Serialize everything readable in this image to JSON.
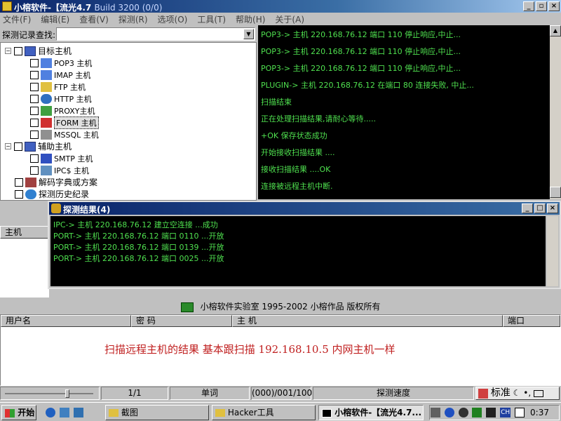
{
  "window": {
    "title": "小榕软件-【流光4.7",
    "title_suffix": "Build 3200 (0/0)"
  },
  "menu": [
    "文件(F)",
    "编辑(E)",
    "查看(V)",
    "探测(R)",
    "选项(O)",
    "工具(T)",
    "帮助(H)",
    "关于(A)"
  ],
  "search": {
    "label": "探测记录查找:",
    "value": ""
  },
  "tree": {
    "root": "目标主机",
    "targets": [
      "POP3 主机",
      "IMAP 主机",
      "FTP  主机",
      "HTTP 主机",
      "PROXY主机",
      "FORM 主机",
      "MSSQL  主机"
    ],
    "aux_root": "辅助主机",
    "aux": [
      "SMTP 主机",
      "IPC$ 主机"
    ],
    "dict": "解码字典或方案",
    "history": "探测历史纪录"
  },
  "console_lines": [
    "POP3-> 主机 220.168.76.12 端口 110 停止响应,中止...",
    "POP3-> 主机 220.168.76.12 端口 110 停止响应,中止...",
    "POP3-> 主机 220.168.76.12 端口 110 停止响应,中止...",
    "PLUGIN-> 主机 220.168.76.12 在端口 80 连接失败, 中止...",
    "扫描结束",
    "正在处理扫描结果,请耐心等待.....",
    "+OK 保存状态成功",
    "开始接收扫描结果 ....",
    "接收扫描结果 ....OK",
    "连接被远程主机中断."
  ],
  "host_panel": {
    "header": "主机"
  },
  "result_window": {
    "title": "探测结果(4)",
    "lines": [
      "IPC-> 主机 220.168.76.12 建立空连接 ...成功",
      "PORT-> 主机 220.168.76.12 端口 0110 ...开放",
      "PORT-> 主机 220.168.76.12 端口 0139 ...开放",
      "PORT-> 主机 220.168.76.12 端口 0025 ...开放"
    ]
  },
  "copyright": "小榕软件实验室 1995-2002 小榕作品 版权所有",
  "table": {
    "columns": [
      "用户名",
      "密  码",
      "主  机",
      "端口"
    ],
    "note": "扫描远程主机的结果   基本跟扫描 192.168.10.5 内网主机一样"
  },
  "status": {
    "page": "1/1",
    "mode": "单词",
    "count": "(000)/001/100",
    "speed": "探测速度"
  },
  "ime": {
    "label": "标准"
  },
  "taskbar": {
    "start": "开始",
    "tasks": [
      "截图",
      "Hacker工具",
      "小榕软件-【流光4.7..."
    ],
    "clock": "0:37",
    "ch": "CH"
  }
}
